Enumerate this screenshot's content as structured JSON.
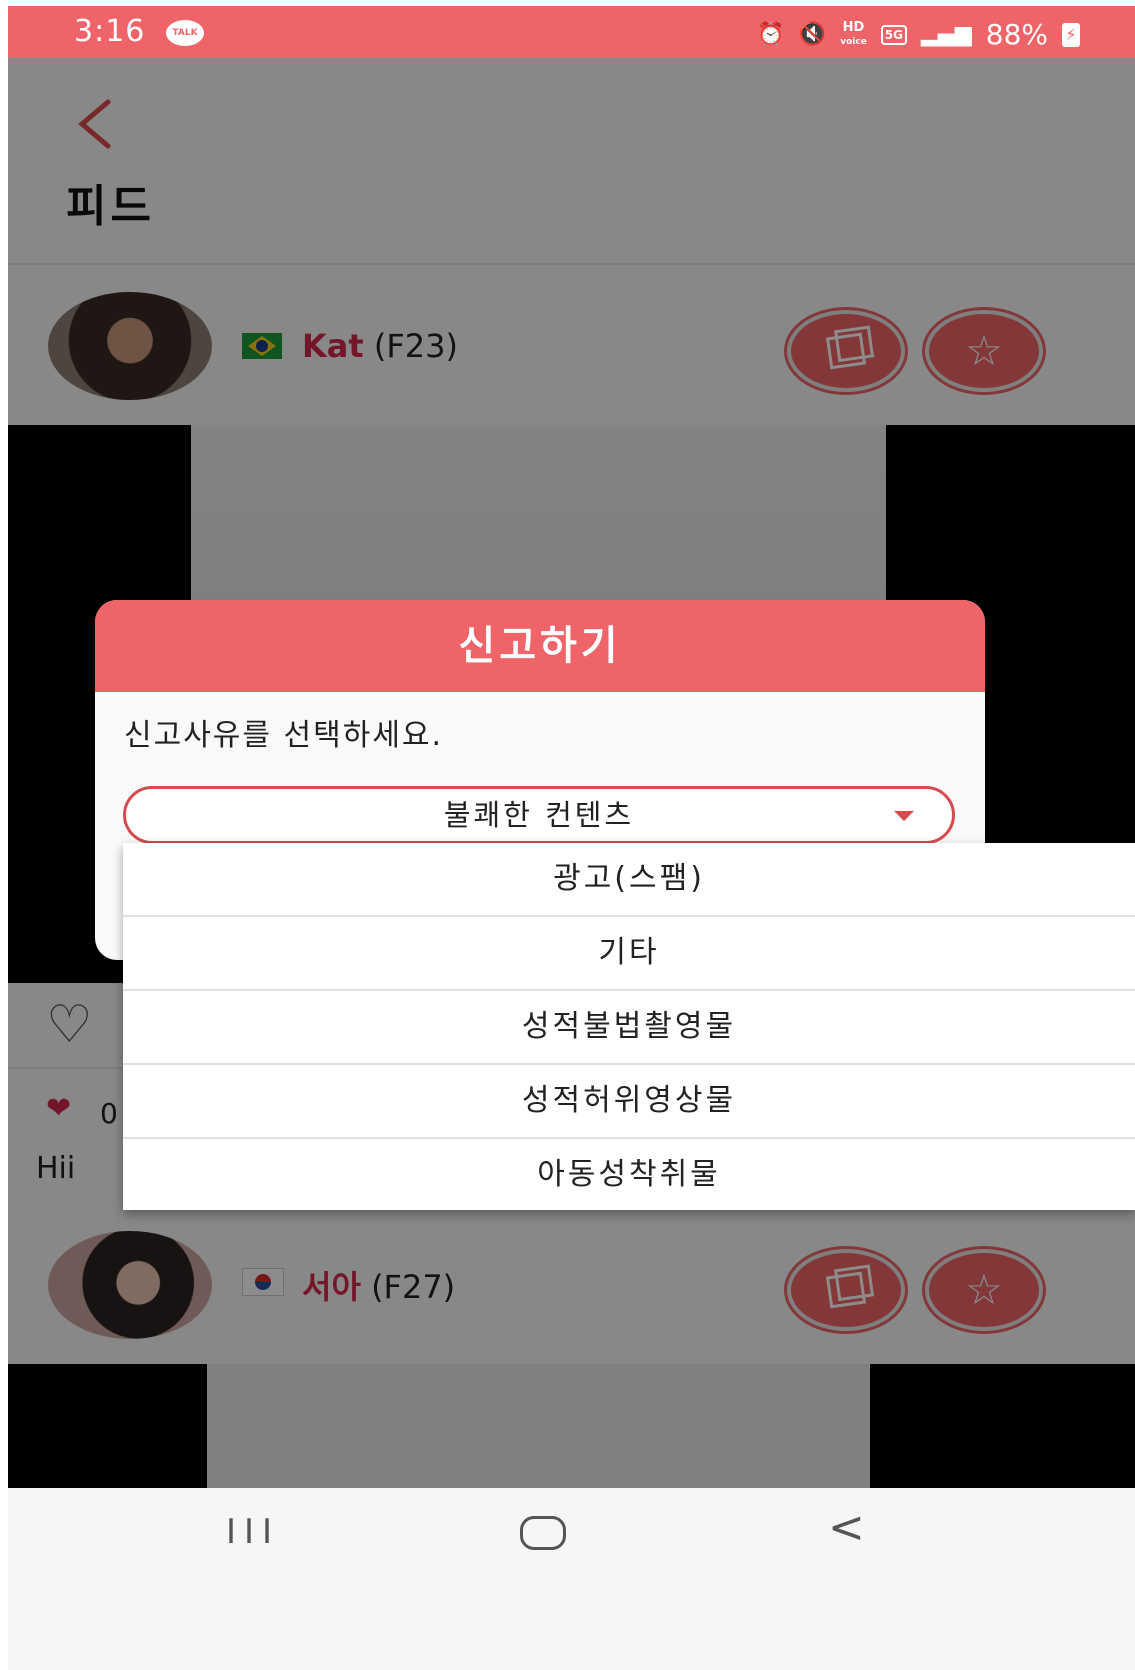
{
  "status_bar": {
    "time": "3:16",
    "talk_badge": "TALK",
    "hd_label": "HD",
    "hd_sub": "voice",
    "network": "5G",
    "battery": "88%"
  },
  "header": {
    "back_glyph": "<",
    "title": "피드"
  },
  "feed": [
    {
      "name": "Kat",
      "meta": "(F23)",
      "flag": "brazil-flag"
    },
    {
      "name": "서아",
      "meta": "(F27)",
      "flag": "korea-flag"
    }
  ],
  "post": {
    "likes": "0",
    "caption": "Hii"
  },
  "dialog": {
    "title": "신고하기",
    "prompt": "신고사유를 선택하세요.",
    "selected": "불쾌한 컨텐츠"
  },
  "dropdown": {
    "options": [
      "광고(스팸)",
      "기타",
      "성적불법촬영물",
      "성적허위영상물",
      "아동성착취물"
    ]
  },
  "colors": {
    "accent": "#ef6468",
    "name_red": "#d3284b"
  },
  "nav": {
    "recent": "III",
    "back": "<"
  }
}
